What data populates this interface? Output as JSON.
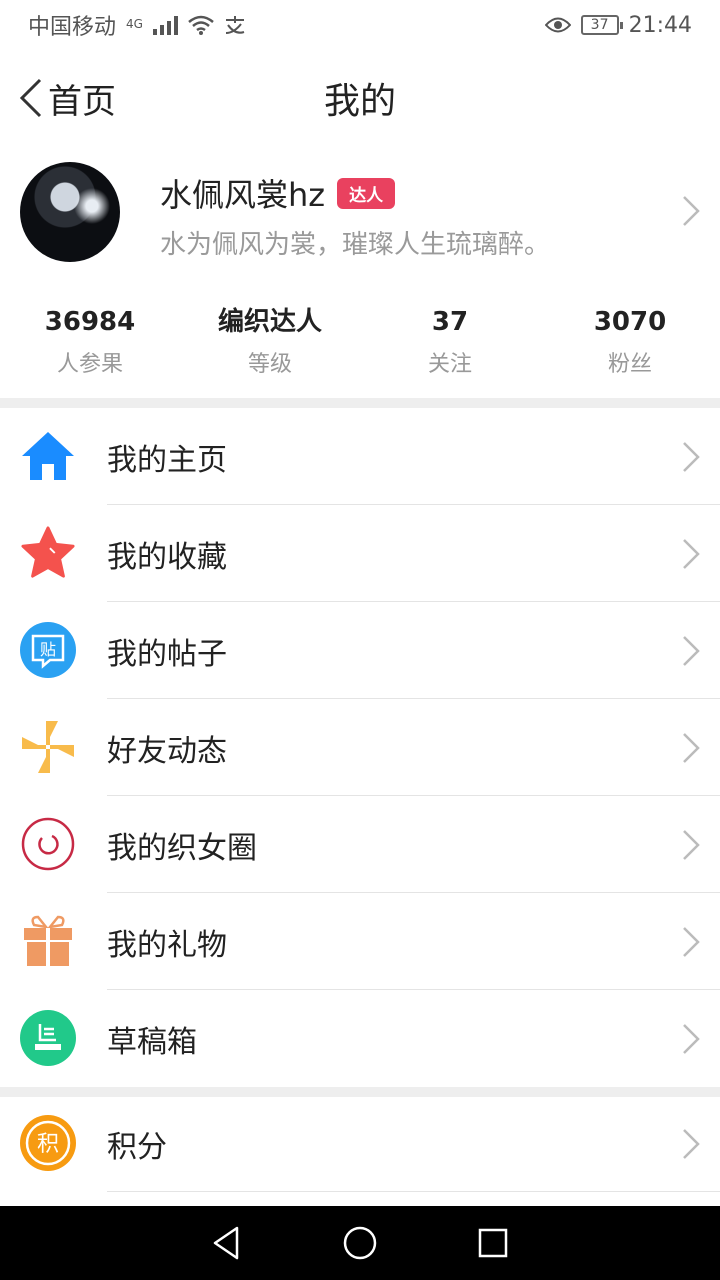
{
  "status_bar": {
    "carrier": "中国移动",
    "network": "4G",
    "battery": "37",
    "time": "21:44"
  },
  "header": {
    "back_label": "首页",
    "title": "我的"
  },
  "profile": {
    "username": "水佩风裳hz",
    "badge": "达人",
    "signature": "水为佩风为裳，璀璨人生琉璃醉。"
  },
  "stats": [
    {
      "value": "36984",
      "label": "人参果"
    },
    {
      "value": "编织达人",
      "label": "等级"
    },
    {
      "value": "37",
      "label": "关注"
    },
    {
      "value": "3070",
      "label": "粉丝"
    }
  ],
  "menu_group1": [
    {
      "label": "我的主页",
      "icon": "home-icon",
      "color": "#1a8cff"
    },
    {
      "label": "我的收藏",
      "icon": "star-icon",
      "color": "#f4524d"
    },
    {
      "label": "我的帖子",
      "icon": "post-icon",
      "color": "#2aa1f2"
    },
    {
      "label": "好友动态",
      "icon": "pinwheel-icon",
      "color": "#f8bb4b"
    },
    {
      "label": "我的织女圈",
      "icon": "circle-icon",
      "color": "#c72a45"
    },
    {
      "label": "我的礼物",
      "icon": "gift-icon",
      "color": "#ef9a63"
    },
    {
      "label": "草稿箱",
      "icon": "drafts-icon",
      "color": "#21c98a"
    }
  ],
  "menu_group2": [
    {
      "label": "积分",
      "icon": "points-icon",
      "color": "#f79b11"
    }
  ],
  "icons": {
    "post_glyph": "贴",
    "points_glyph": "积"
  }
}
